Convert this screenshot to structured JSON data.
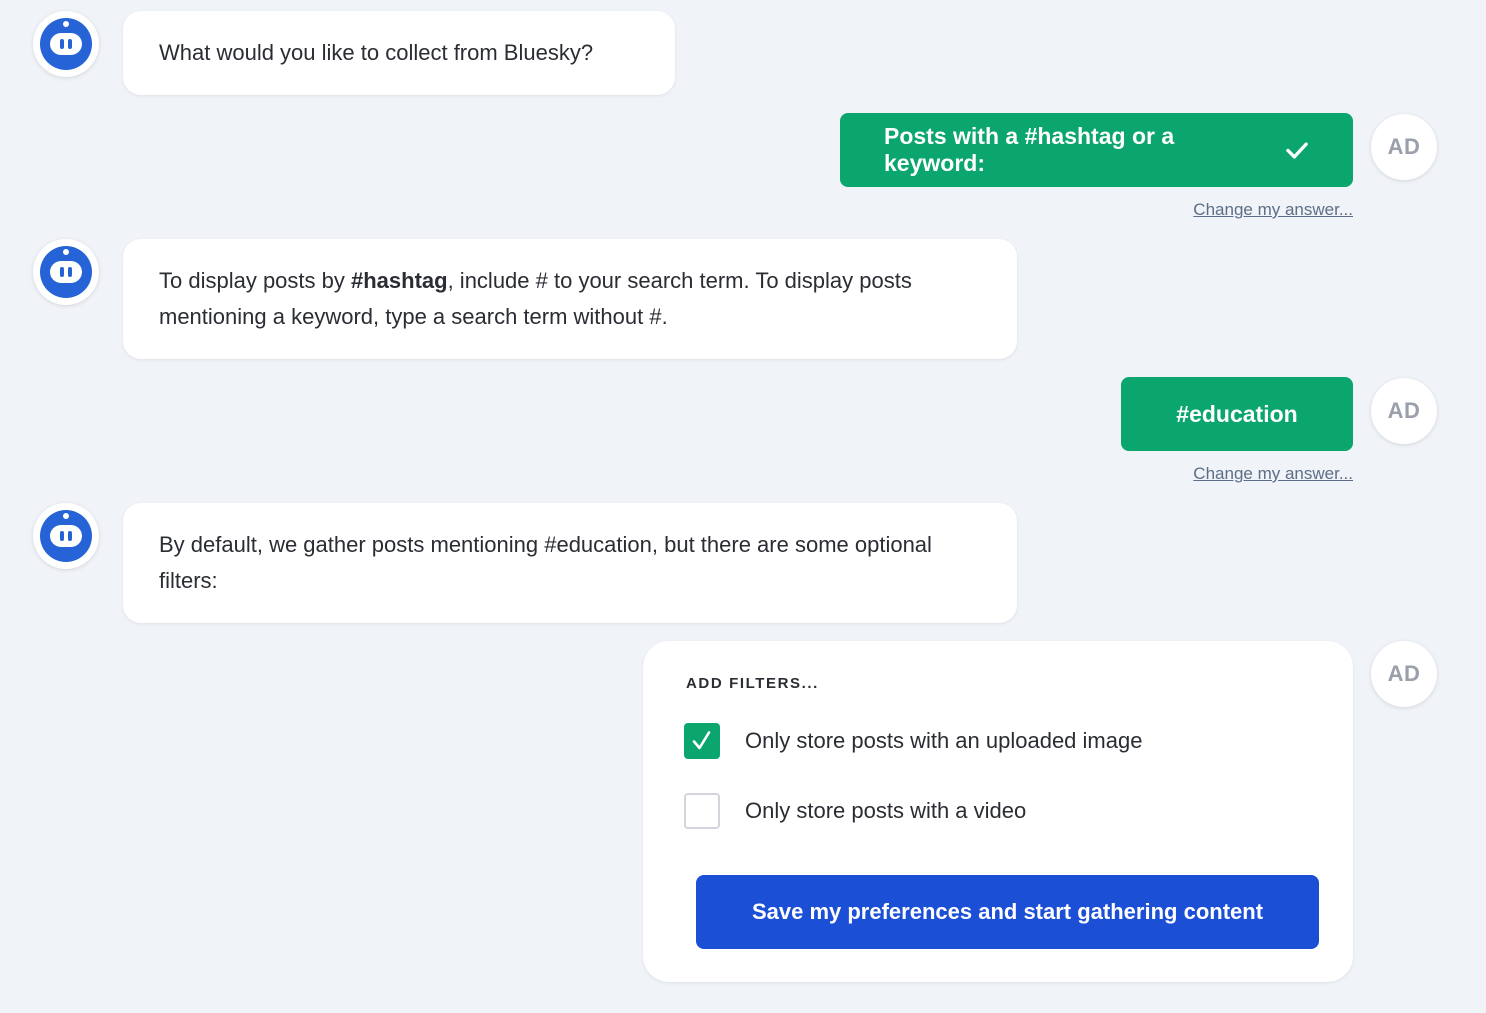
{
  "conversation": {
    "bot_message_1": "What would you like to collect from Bluesky?",
    "user_reply_1": "Posts with a #hashtag or a keyword:",
    "bot_message_2_before": "To display posts by ",
    "bot_message_2_hashtag": "#hashtag",
    "bot_message_2_after": ", include # to your search term. To display posts mentioning a keyword, type a search term without #.",
    "user_reply_2": "#education",
    "bot_message_3": "By default, we gather posts mentioning #education, but there are some optional filters:",
    "change_link": "Change my answer..."
  },
  "user": {
    "initials": "AD"
  },
  "filters": {
    "heading": "ADD FILTERS...",
    "options": [
      {
        "label": "Only store posts with an uploaded image",
        "checked": true
      },
      {
        "label": "Only store posts with a video",
        "checked": false
      }
    ],
    "save_label": "Save my preferences and start gathering content"
  },
  "icons": {
    "bot": "robot-face-icon",
    "checkmark": "check-icon",
    "checkbox_check": "check-icon"
  },
  "colors": {
    "background": "#f0f3f8",
    "accent_green": "#0aa66e",
    "primary_blue": "#1b4fd6",
    "bot_blue": "#2563d6",
    "link": "#5c6f87"
  }
}
